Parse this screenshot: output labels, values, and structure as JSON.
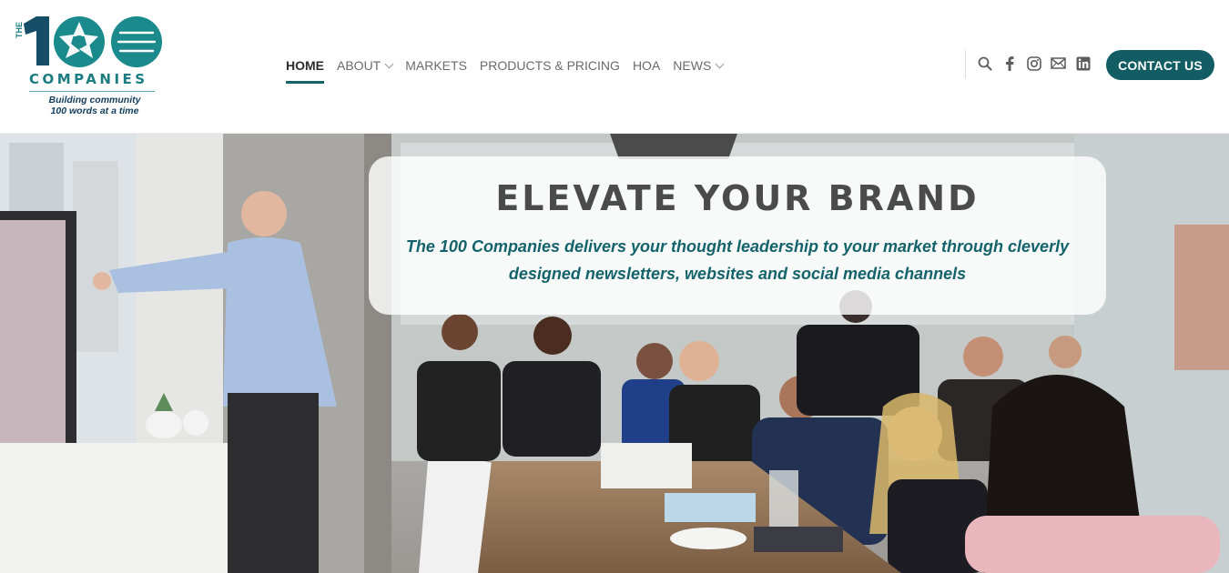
{
  "logo": {
    "number": "100",
    "prefix": "THE",
    "name": "COMPANIES",
    "tagline_line1": "Building community",
    "tagline_line2": "100 words at a time",
    "color": "#1b7d80"
  },
  "nav": {
    "items": [
      {
        "label": "HOME",
        "active": true,
        "dropdown": false
      },
      {
        "label": "ABOUT",
        "active": false,
        "dropdown": true
      },
      {
        "label": "MARKETS",
        "active": false,
        "dropdown": false
      },
      {
        "label": "PRODUCTS & PRICING",
        "active": false,
        "dropdown": false
      },
      {
        "label": "HOA",
        "active": false,
        "dropdown": false
      },
      {
        "label": "NEWS",
        "active": false,
        "dropdown": true
      }
    ]
  },
  "header_icons": [
    "search-icon",
    "facebook-icon",
    "instagram-icon",
    "email-icon",
    "linkedin-icon"
  ],
  "cta": {
    "label": "CONTACT US",
    "color": "#125d64"
  },
  "hero": {
    "title": "ELEVATE YOUR BRAND",
    "subtitle": "The 100 Companies delivers your thought leadership to your market through cleverly designed newsletters, websites and social media channels",
    "subtitle_color": "#14636a"
  }
}
